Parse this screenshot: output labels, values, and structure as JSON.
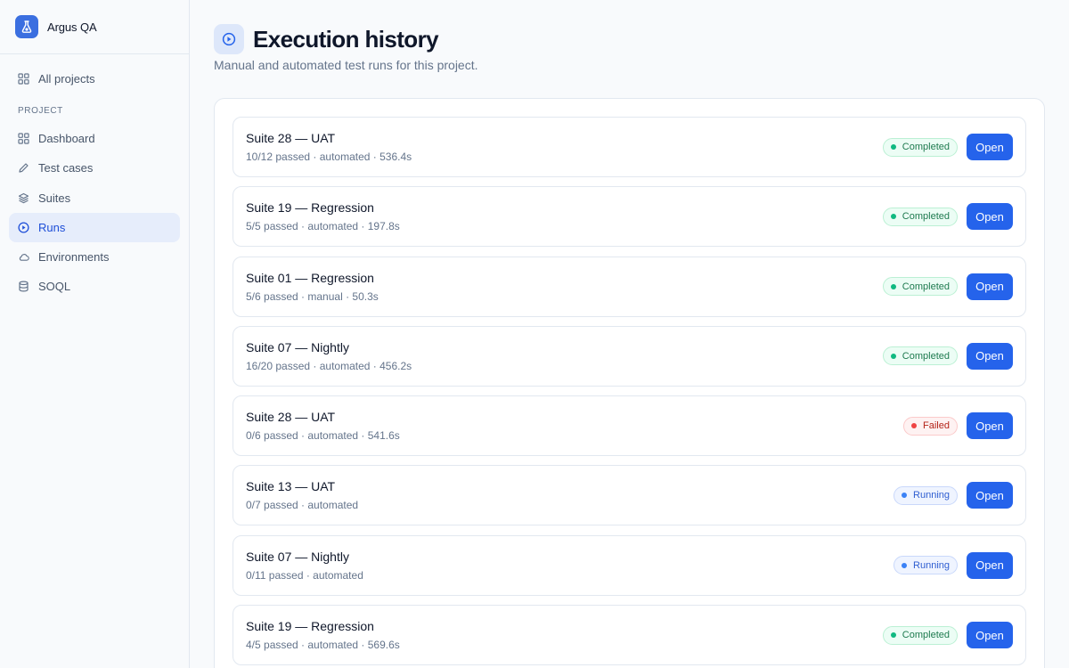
{
  "app": {
    "name": "Argus QA"
  },
  "sidebar": {
    "top_item": {
      "label": "All projects",
      "icon": "grid-icon"
    },
    "section_label": "PROJECT",
    "items": [
      {
        "label": "Dashboard",
        "icon": "grid-icon",
        "active": false
      },
      {
        "label": "Test cases",
        "icon": "pencil-icon",
        "active": false
      },
      {
        "label": "Suites",
        "icon": "layers-icon",
        "active": false
      },
      {
        "label": "Runs",
        "icon": "play-circle-icon",
        "active": true
      },
      {
        "label": "Environments",
        "icon": "cloud-icon",
        "active": false
      },
      {
        "label": "SOQL",
        "icon": "database-icon",
        "active": false
      }
    ]
  },
  "header": {
    "title": "Execution history",
    "subtitle": "Manual and automated test runs for this project."
  },
  "runs": [
    {
      "title": "Suite 28 — UAT",
      "meta": "10/12 passed · automated · 536.4s",
      "status": "Completed",
      "status_type": "completed",
      "action": "Open"
    },
    {
      "title": "Suite 19 — Regression",
      "meta": "5/5 passed · automated · 197.8s",
      "status": "Completed",
      "status_type": "completed",
      "action": "Open"
    },
    {
      "title": "Suite 01 — Regression",
      "meta": "5/6 passed · manual · 50.3s",
      "status": "Completed",
      "status_type": "completed",
      "action": "Open"
    },
    {
      "title": "Suite 07 — Nightly",
      "meta": "16/20 passed · automated · 456.2s",
      "status": "Completed",
      "status_type": "completed",
      "action": "Open"
    },
    {
      "title": "Suite 28 — UAT",
      "meta": "0/6 passed · automated · 541.6s",
      "status": "Failed",
      "status_type": "failed",
      "action": "Open"
    },
    {
      "title": "Suite 13 — UAT",
      "meta": "0/7 passed · automated",
      "status": "Running",
      "status_type": "running",
      "action": "Open"
    },
    {
      "title": "Suite 07 — Nightly",
      "meta": "0/11 passed · automated",
      "status": "Running",
      "status_type": "running",
      "action": "Open"
    },
    {
      "title": "Suite 19 — Regression",
      "meta": "4/5 passed · automated · 569.6s",
      "status": "Completed",
      "status_type": "completed",
      "action": "Open"
    }
  ],
  "colors": {
    "accent": "#2563eb",
    "completed": "#10b981",
    "failed": "#ef4444",
    "running": "#3b82f6"
  }
}
